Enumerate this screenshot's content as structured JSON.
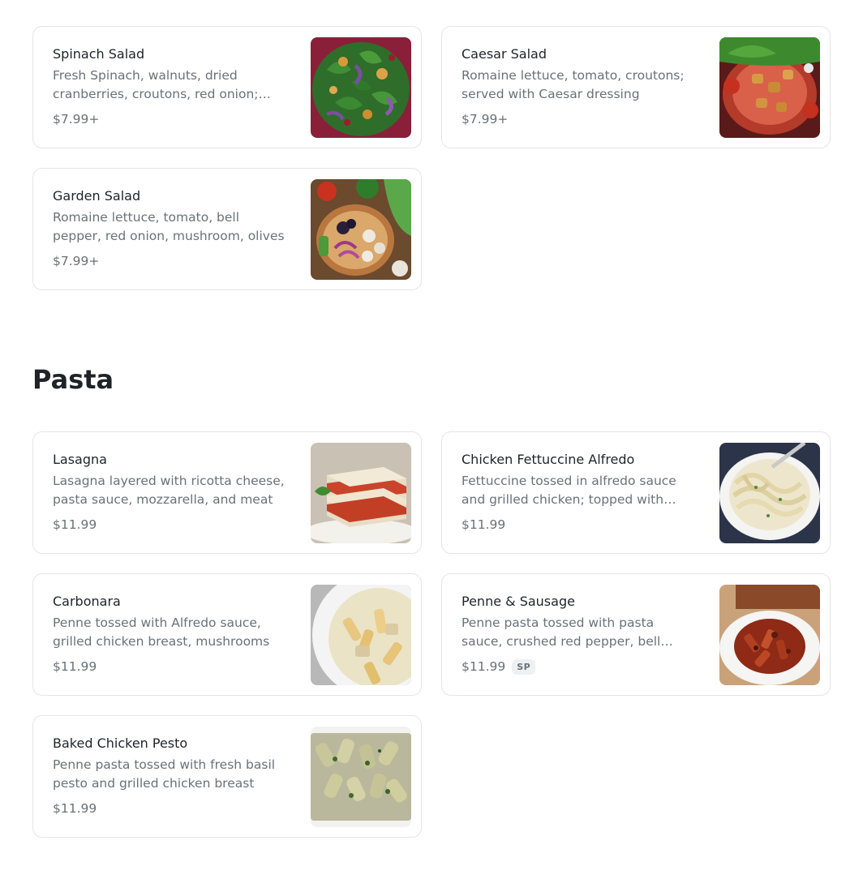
{
  "sections": [
    {
      "title": "",
      "items": [
        {
          "name": "Spinach Salad",
          "description": "Fresh Spinach, walnuts, dried cranberries, croutons, red onion; served with",
          "price": "$7.99+",
          "badge": "",
          "image": "spinach-salad"
        },
        {
          "name": "Caesar Salad",
          "description": "Romaine lettuce, tomato, croutons; served with Caesar dressing",
          "price": "$7.99+",
          "badge": "",
          "image": "caesar-salad"
        },
        {
          "name": "Garden Salad",
          "description": "Romaine lettuce, tomato, bell pepper, red onion, mushroom, olives",
          "price": "$7.99+",
          "badge": "",
          "image": "garden-salad"
        }
      ]
    },
    {
      "title": "Pasta",
      "items": [
        {
          "name": "Lasagna",
          "description": "Lasagna layered with ricotta cheese, pasta sauce, mozzarella, and meat",
          "price": "$11.99",
          "badge": "",
          "image": "lasagna"
        },
        {
          "name": "Chicken Fettuccine Alfredo",
          "description": "Fettuccine tossed in alfredo sauce and grilled chicken; topped with parmesan",
          "price": "$11.99",
          "badge": "",
          "image": "fettuccine-alfredo"
        },
        {
          "name": "Carbonara",
          "description": "Penne tossed with Alfredo sauce, grilled chicken breast, mushrooms",
          "price": "$11.99",
          "badge": "",
          "image": "carbonara"
        },
        {
          "name": "Penne & Sausage",
          "description": "Penne pasta tossed with pasta sauce, crushed red pepper, bell peppers",
          "price": "$11.99",
          "badge": "SP",
          "image": "penne-sausage"
        },
        {
          "name": "Baked Chicken Pesto",
          "description": "Penne pasta tossed with fresh basil pesto and grilled chicken breast",
          "price": "$11.99",
          "badge": "",
          "image": "chicken-pesto"
        }
      ]
    }
  ]
}
